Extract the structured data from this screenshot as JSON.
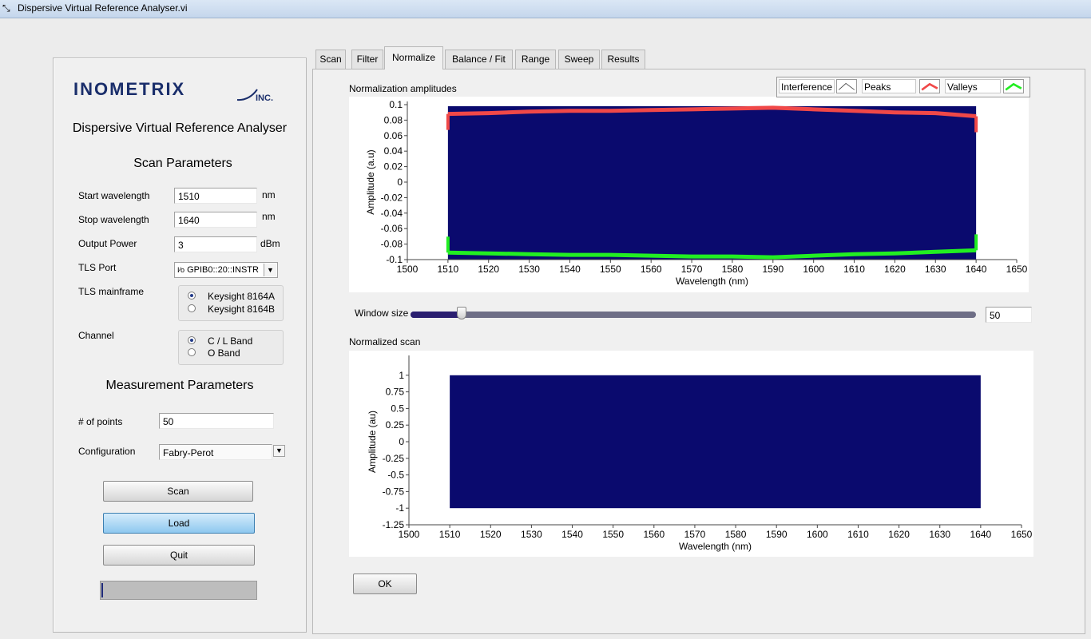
{
  "window": {
    "title": "Dispersive Virtual Reference Analyser.vi"
  },
  "sidebar": {
    "logo_text": "INOMETRIX",
    "logo_suffix": "INC.",
    "app_title": "Dispersive Virtual Reference Analyser",
    "scan_params_heading": "Scan Parameters",
    "start_wavelength": {
      "label": "Start wavelength",
      "value": "1510",
      "unit": "nm"
    },
    "stop_wavelength": {
      "label": "Stop wavelength",
      "value": "1640",
      "unit": "nm"
    },
    "output_power": {
      "label": "Output Power",
      "value": "3",
      "unit": "dBm"
    },
    "tls_port": {
      "label": "TLS Port",
      "prefix": "I⁄o",
      "value": "GPIB0::20::INSTR"
    },
    "tls_mainframe": {
      "label": "TLS mainframe",
      "options": [
        "Keysight 8164A",
        "Keysight 8164B"
      ],
      "selected": 0
    },
    "channel": {
      "label": "Channel",
      "options": [
        "C / L Band",
        "O Band"
      ],
      "selected": 0
    },
    "measurement_heading": "Measurement Parameters",
    "num_points": {
      "label": "# of points",
      "value": "50"
    },
    "configuration": {
      "label": "Configuration",
      "value": "Fabry-Perot"
    },
    "buttons": {
      "scan": "Scan",
      "load": "Load",
      "quit": "Quit"
    },
    "progress": 0.01
  },
  "tabs": [
    "Scan",
    "Filter",
    "Normalize",
    "Balance / Fit",
    "Range",
    "Sweep",
    "Results"
  ],
  "selected_tab": "Normalize",
  "normalize": {
    "amp_graph_title": "Normalization amplitudes",
    "legend": {
      "interference": "Interference",
      "peaks": "Peaks",
      "valleys": "Valleys"
    },
    "window_size": {
      "label": "Window size",
      "value": "50",
      "fraction": 0.09
    },
    "norm_graph_title": "Normalized scan",
    "ok_label": "OK"
  },
  "colors": {
    "fill": "#0a0a6e",
    "peaks": "#f04848",
    "valleys": "#22ee22"
  },
  "chart_data": [
    {
      "type": "area",
      "title": "Normalization amplitudes",
      "xlabel": "Wavelength (nm)",
      "ylabel": "Amplitude (a.u)",
      "xlim": [
        1500,
        1650
      ],
      "ylim": [
        -0.1,
        0.1
      ],
      "xticks": [
        "1500",
        "1510",
        "1520",
        "1530",
        "1540",
        "1550",
        "1560",
        "1570",
        "1580",
        "1590",
        "1600",
        "1610",
        "1620",
        "1630",
        "1640",
        "1650"
      ],
      "yticks": [
        "0.1",
        "0.08",
        "0.06",
        "0.04",
        "0.02",
        "0",
        "-0.02",
        "-0.04",
        "-0.06",
        "-0.08",
        "-0.1"
      ],
      "series": [
        {
          "name": "Interference",
          "x": [
            1510,
            1640
          ],
          "range": [
            -0.1,
            0.098
          ]
        },
        {
          "name": "Peaks",
          "x": [
            1510,
            1520,
            1530,
            1540,
            1550,
            1560,
            1570,
            1580,
            1590,
            1600,
            1610,
            1620,
            1630,
            1640
          ],
          "values": [
            0.088,
            0.089,
            0.091,
            0.092,
            0.092,
            0.093,
            0.094,
            0.095,
            0.096,
            0.094,
            0.092,
            0.09,
            0.089,
            0.085
          ]
        },
        {
          "name": "Valleys",
          "x": [
            1510,
            1520,
            1530,
            1540,
            1550,
            1560,
            1570,
            1580,
            1590,
            1600,
            1610,
            1620,
            1630,
            1640
          ],
          "values": [
            -0.091,
            -0.092,
            -0.093,
            -0.094,
            -0.094,
            -0.095,
            -0.096,
            -0.096,
            -0.097,
            -0.095,
            -0.093,
            -0.092,
            -0.09,
            -0.088
          ]
        }
      ],
      "grid": false
    },
    {
      "type": "area",
      "title": "Normalized scan",
      "xlabel": "Wavelength (nm)",
      "ylabel": "Amplitude (au)",
      "xlim": [
        1500,
        1650
      ],
      "ylim": [
        -1.25,
        1.25
      ],
      "xticks": [
        "1500",
        "1510",
        "1520",
        "1530",
        "1540",
        "1550",
        "1560",
        "1570",
        "1580",
        "1590",
        "1600",
        "1610",
        "1620",
        "1630",
        "1640",
        "1650"
      ],
      "yticks": [
        "1",
        "0.75",
        "0.5",
        "0.25",
        "0",
        "-0.25",
        "-0.5",
        "-0.75",
        "-1",
        "-1.25"
      ],
      "series": [
        {
          "x": [
            1510,
            1640
          ],
          "range": [
            -1,
            1
          ]
        }
      ],
      "grid": false
    }
  ]
}
